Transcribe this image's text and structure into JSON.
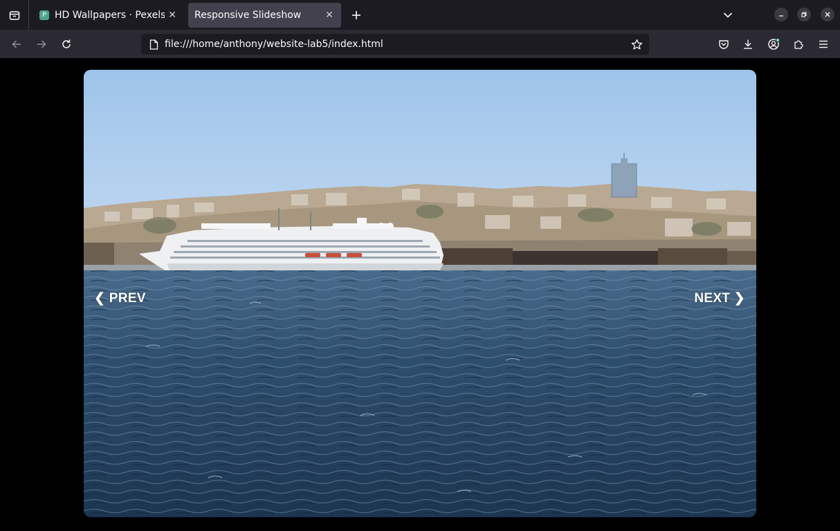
{
  "browser": {
    "tabs": [
      {
        "title": "HD Wallpapers · Pexels",
        "favicon": "P",
        "active": false
      },
      {
        "title": "Responsive Slideshow",
        "active": true
      }
    ],
    "url": "file:///home/anthony/website-lab5/index.html"
  },
  "slideshow": {
    "prev_label": "❮ PREV",
    "next_label": "NEXT ❯",
    "image_alt": "cityscape-harbor-photo"
  },
  "colors": {
    "tabstrip_bg": "#1c1b22",
    "navbar_bg": "#2b2a33",
    "active_tab": "#42414d",
    "page_bg": "#000000"
  }
}
